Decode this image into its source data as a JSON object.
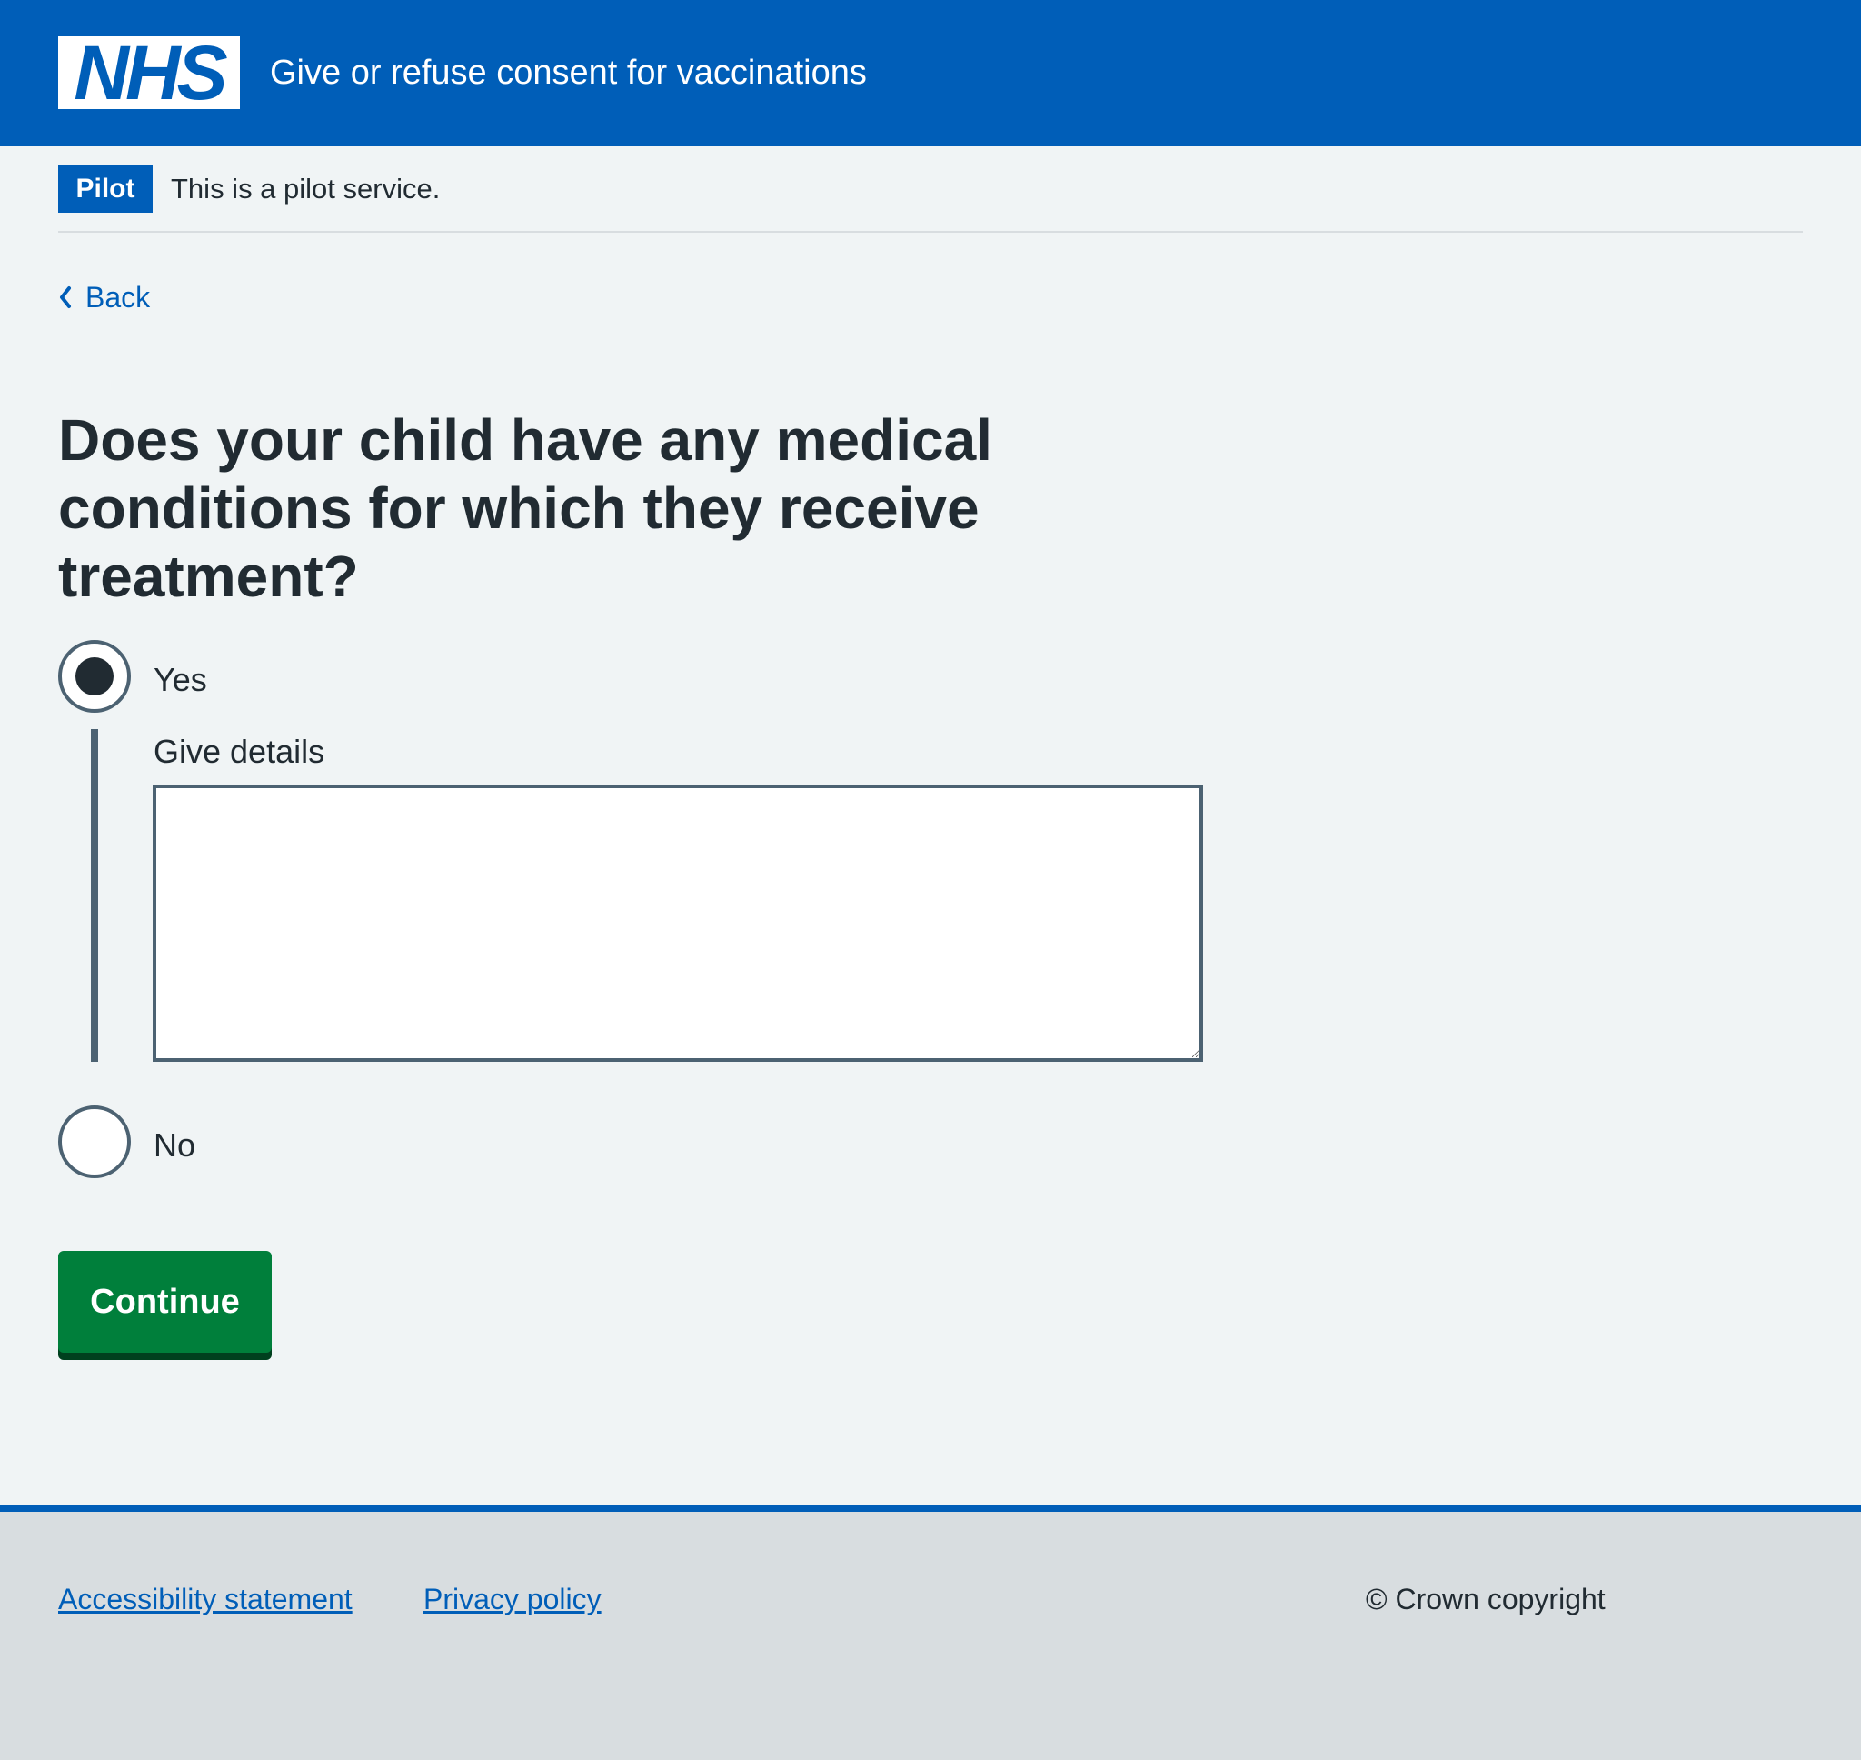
{
  "header": {
    "logo_text": "NHS",
    "service_name": "Give or refuse consent for vaccinations"
  },
  "phase_banner": {
    "tag": "Pilot",
    "text": "This is a pilot service."
  },
  "back_link": {
    "label": "Back",
    "icon": "chevron-left-icon"
  },
  "form": {
    "question": "Does your child have any medical conditions for which they receive treatment?",
    "options": [
      {
        "label": "Yes",
        "selected": true
      },
      {
        "label": "No",
        "selected": false
      }
    ],
    "details_label": "Give details",
    "details_value": "",
    "submit_label": "Continue"
  },
  "footer": {
    "links": [
      "Accessibility statement",
      "Privacy policy"
    ],
    "copyright": "© Crown copyright"
  },
  "colors": {
    "nhs_blue": "#005eb8",
    "background": "#f0f4f5",
    "button_green": "#007f3b",
    "text": "#212b32",
    "footer_bg": "#d8dde0"
  }
}
